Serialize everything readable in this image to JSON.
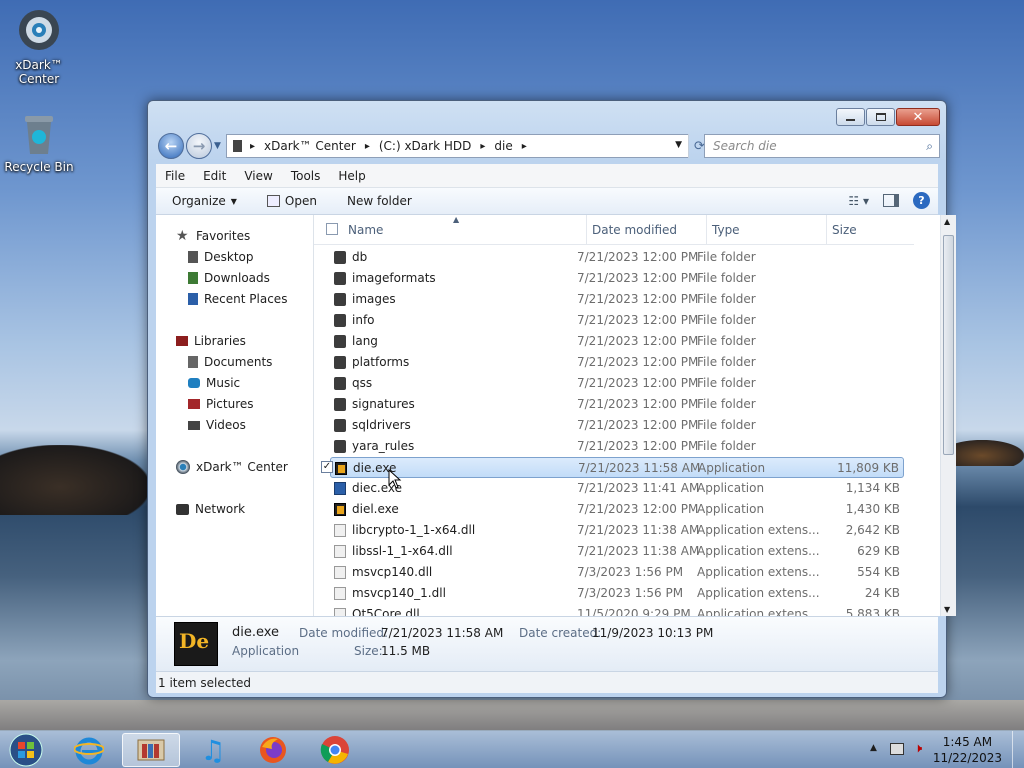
{
  "desktop": {
    "icons": [
      {
        "label_line1": "xDark™",
        "label_line2": "Center"
      },
      {
        "label_line1": "Recycle Bin",
        "label_line2": ""
      }
    ]
  },
  "window": {
    "address": {
      "segments": [
        "xDark™ Center",
        "(C:) xDark HDD",
        "die"
      ],
      "separator": "▸"
    },
    "search_placeholder": "Search die",
    "menu": [
      "File",
      "Edit",
      "View",
      "Tools",
      "Help"
    ],
    "commands": {
      "organize": "Organize",
      "open": "Open",
      "new_folder": "New folder"
    },
    "nav": {
      "favorites": "Favorites",
      "desktop": "Desktop",
      "downloads": "Downloads",
      "recent": "Recent Places",
      "libraries": "Libraries",
      "documents": "Documents",
      "music": "Music",
      "pictures": "Pictures",
      "videos": "Videos",
      "computer": "xDark™ Center",
      "network": "Network"
    },
    "columns": {
      "name": "Name",
      "date": "Date modified",
      "type": "Type",
      "size": "Size"
    },
    "files": [
      {
        "name": "db",
        "date": "7/21/2023 12:00 PM",
        "type": "File folder",
        "size": "",
        "icon": "folder"
      },
      {
        "name": "imageformats",
        "date": "7/21/2023 12:00 PM",
        "type": "File folder",
        "size": "",
        "icon": "folder"
      },
      {
        "name": "images",
        "date": "7/21/2023 12:00 PM",
        "type": "File folder",
        "size": "",
        "icon": "folder"
      },
      {
        "name": "info",
        "date": "7/21/2023 12:00 PM",
        "type": "File folder",
        "size": "",
        "icon": "folder"
      },
      {
        "name": "lang",
        "date": "7/21/2023 12:00 PM",
        "type": "File folder",
        "size": "",
        "icon": "folder"
      },
      {
        "name": "platforms",
        "date": "7/21/2023 12:00 PM",
        "type": "File folder",
        "size": "",
        "icon": "folder"
      },
      {
        "name": "qss",
        "date": "7/21/2023 12:00 PM",
        "type": "File folder",
        "size": "",
        "icon": "folder"
      },
      {
        "name": "signatures",
        "date": "7/21/2023 12:00 PM",
        "type": "File folder",
        "size": "",
        "icon": "folder"
      },
      {
        "name": "sqldrivers",
        "date": "7/21/2023 12:00 PM",
        "type": "File folder",
        "size": "",
        "icon": "folder"
      },
      {
        "name": "yara_rules",
        "date": "7/21/2023 12:00 PM",
        "type": "File folder",
        "size": "",
        "icon": "folder"
      },
      {
        "name": "die.exe",
        "date": "7/21/2023 11:58 AM",
        "type": "Application",
        "size": "11,809 KB",
        "icon": "die",
        "selected": true
      },
      {
        "name": "diec.exe",
        "date": "7/21/2023 11:41 AM",
        "type": "Application",
        "size": "1,134 KB",
        "icon": "app"
      },
      {
        "name": "diel.exe",
        "date": "7/21/2023 12:00 PM",
        "type": "Application",
        "size": "1,430 KB",
        "icon": "die"
      },
      {
        "name": "libcrypto-1_1-x64.dll",
        "date": "7/21/2023 11:38 AM",
        "type": "Application extens...",
        "size": "2,642 KB",
        "icon": "dll"
      },
      {
        "name": "libssl-1_1-x64.dll",
        "date": "7/21/2023 11:38 AM",
        "type": "Application extens...",
        "size": "629 KB",
        "icon": "dll"
      },
      {
        "name": "msvcp140.dll",
        "date": "7/3/2023 1:56 PM",
        "type": "Application extens...",
        "size": "554 KB",
        "icon": "dll"
      },
      {
        "name": "msvcp140_1.dll",
        "date": "7/3/2023 1:56 PM",
        "type": "Application extens...",
        "size": "24 KB",
        "icon": "dll"
      },
      {
        "name": "Qt5Core.dll",
        "date": "11/5/2020 9:29 PM",
        "type": "Application extens...",
        "size": "5,883 KB",
        "icon": "dll"
      }
    ],
    "details": {
      "name": "die.exe",
      "kind": "Application",
      "modified_label": "Date modified:",
      "modified": "7/21/2023 11:58 AM",
      "created_label": "Date created:",
      "created": "11/9/2023 10:13 PM",
      "size_label": "Size:",
      "size": "11.5 MB"
    },
    "status": "1 item selected"
  },
  "taskbar": {
    "time": "1:45 AM",
    "date": "11/22/2023"
  },
  "colors": {
    "selection": "#c2dcf8",
    "accent": "#2f68b8"
  }
}
